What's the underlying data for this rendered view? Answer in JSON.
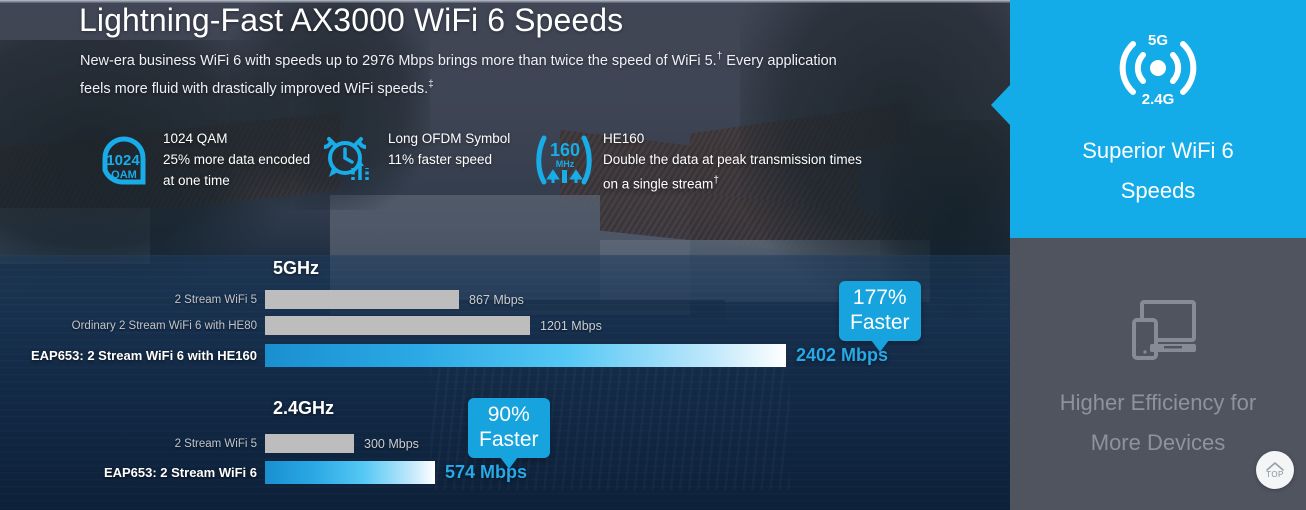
{
  "hero": {
    "title": "Lightning-Fast AX3000 WiFi 6 Speeds",
    "subtitle_line1": "New-era business WiFi 6 with speeds up to 2976 Mbps brings more than twice the speed of WiFi 5.",
    "subtitle_sup1": "†",
    "subtitle_line1b": " Every",
    "subtitle_line2": "application feels more fluid with drastically improved WiFi speeds.",
    "subtitle_sup2": "‡"
  },
  "features": [
    {
      "icon": "qam-1024-icon",
      "icon_primary": "1024",
      "icon_secondary": "QAM",
      "title": "1024 QAM",
      "desc": "25% more data encoded at one time"
    },
    {
      "icon": "alarm-clock-speed-icon",
      "title": "Long OFDM Symbol",
      "desc": "11% faster speed"
    },
    {
      "icon": "he160-bandwidth-icon",
      "icon_primary": "160",
      "icon_secondary": "MHz",
      "title": "HE160",
      "desc": "Double the data at peak transmission times on a single stream",
      "desc_sup": "†"
    }
  ],
  "chart_data": [
    {
      "type": "bar",
      "title": "5GHz",
      "orientation": "horizontal",
      "unit": "Mbps",
      "xlim": [
        0,
        2402
      ],
      "grid": false,
      "categories": [
        "2 Stream WiFi 5",
        "Ordinary 2 Stream WiFi 6 with HE80",
        "EAP653: 2 Stream WiFi 6 with HE160"
      ],
      "values": [
        867,
        1201,
        2402
      ],
      "value_labels": [
        "867 Mbps",
        "1201 Mbps",
        "2402 Mbps"
      ],
      "highlight_index": 2,
      "annotation": "177% Faster",
      "annotation_percent": "177%",
      "annotation_word": "Faster"
    },
    {
      "type": "bar",
      "title": "2.4GHz",
      "orientation": "horizontal",
      "unit": "Mbps",
      "xlim": [
        0,
        2402
      ],
      "grid": false,
      "categories": [
        "2 Stream WiFi 5",
        "EAP653: 2 Stream WiFi 6"
      ],
      "values": [
        300,
        574
      ],
      "value_labels": [
        "300 Mbps",
        "574 Mbps"
      ],
      "highlight_index": 1,
      "annotation": "90% Faster",
      "annotation_percent": "90%",
      "annotation_word": "Faster"
    }
  ],
  "side_panels": [
    {
      "icon": "dual-band-wifi-icon",
      "icon_top_label": "5G",
      "icon_bottom_label": "2.4G",
      "title_line1": "Superior WiFi 6",
      "title_line2": "Speeds",
      "active": true,
      "background": "#14ace8"
    },
    {
      "icon": "devices-icon",
      "title_line1": "Higher Efficiency for",
      "title_line2": "More Devices",
      "active": false,
      "background": "#50545f"
    }
  ],
  "back_to_top": {
    "icon": "chevron-up-icon",
    "label": "TOP"
  },
  "colors": {
    "accent": "#14ace8",
    "badge": "#17a3dd",
    "highlight_value": "#27a9e8",
    "bar_grey": "#bdbdbd",
    "panel_inactive": "#50545f"
  }
}
